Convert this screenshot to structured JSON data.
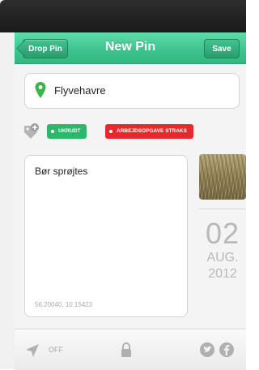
{
  "navbar": {
    "back_label": "Drop Pin",
    "title": "New Pin",
    "save_label": "Save"
  },
  "location": {
    "value": "Flyvehavre",
    "icon": "map-pin-icon"
  },
  "tags": [
    {
      "label": "UKRUDT",
      "color": "#2fb66b"
    },
    {
      "label": "ARBEJDSOPGAVE STRAKS",
      "color": "#e8282c"
    }
  ],
  "note": {
    "text": "Bør sprøjtes",
    "coordinates": "56.20040, 10.15423"
  },
  "date": {
    "day": "02",
    "month": "AUG.",
    "year": "2012"
  },
  "bottombar": {
    "location_toggle": "OFF",
    "icons": [
      "location-arrow-icon",
      "lock-icon",
      "twitter-icon",
      "facebook-icon"
    ]
  },
  "colors": {
    "accent": "#3ec48f",
    "tag_green": "#2fb66b",
    "tag_red": "#e8282c"
  }
}
